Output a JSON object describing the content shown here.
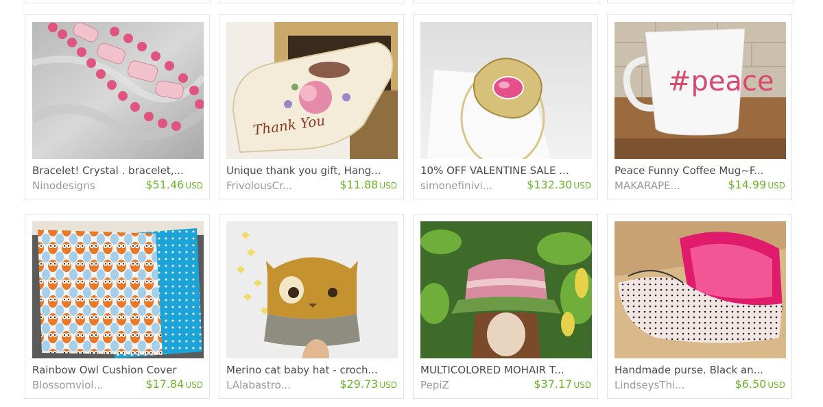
{
  "listings": [
    {
      "title": "Bracelet! Crystal . bracelet,...",
      "shop": "Ninodesigns",
      "price": "$51.46",
      "currency": "USD"
    },
    {
      "title": "Unique thank you gift, Hang...",
      "shop": "FrivolousCr...",
      "price": "$11.88",
      "currency": "USD",
      "image_text": "Thank You"
    },
    {
      "title": "10% OFF VALENTINE SALE ...",
      "shop": "simonefinivi...",
      "price": "$132.30",
      "currency": "USD"
    },
    {
      "title": "Peace Funny Coffee Mug~F...",
      "shop": "MAKARAPE...",
      "price": "$14.99",
      "currency": "USD",
      "image_text": "#peace"
    },
    {
      "title": "Rainbow Owl Cushion Cover",
      "shop": "Blossomviol...",
      "price": "$17.84",
      "currency": "USD"
    },
    {
      "title": "Merino cat baby hat - croch...",
      "shop": "LAlabastro...",
      "price": "$29.73",
      "currency": "USD"
    },
    {
      "title": "MULTICOLORED MOHAIR T...",
      "shop": "PepiZ",
      "price": "$37.17",
      "currency": "USD"
    },
    {
      "title": "Handmade purse. Black an...",
      "shop": "LindseysThi...",
      "price": "$6.50",
      "currency": "USD"
    }
  ],
  "colors": {
    "price_green": "#6ab829",
    "title_text": "#4a4a4a",
    "shop_text": "#9a9a9a",
    "card_border": "#e3e3e3"
  }
}
